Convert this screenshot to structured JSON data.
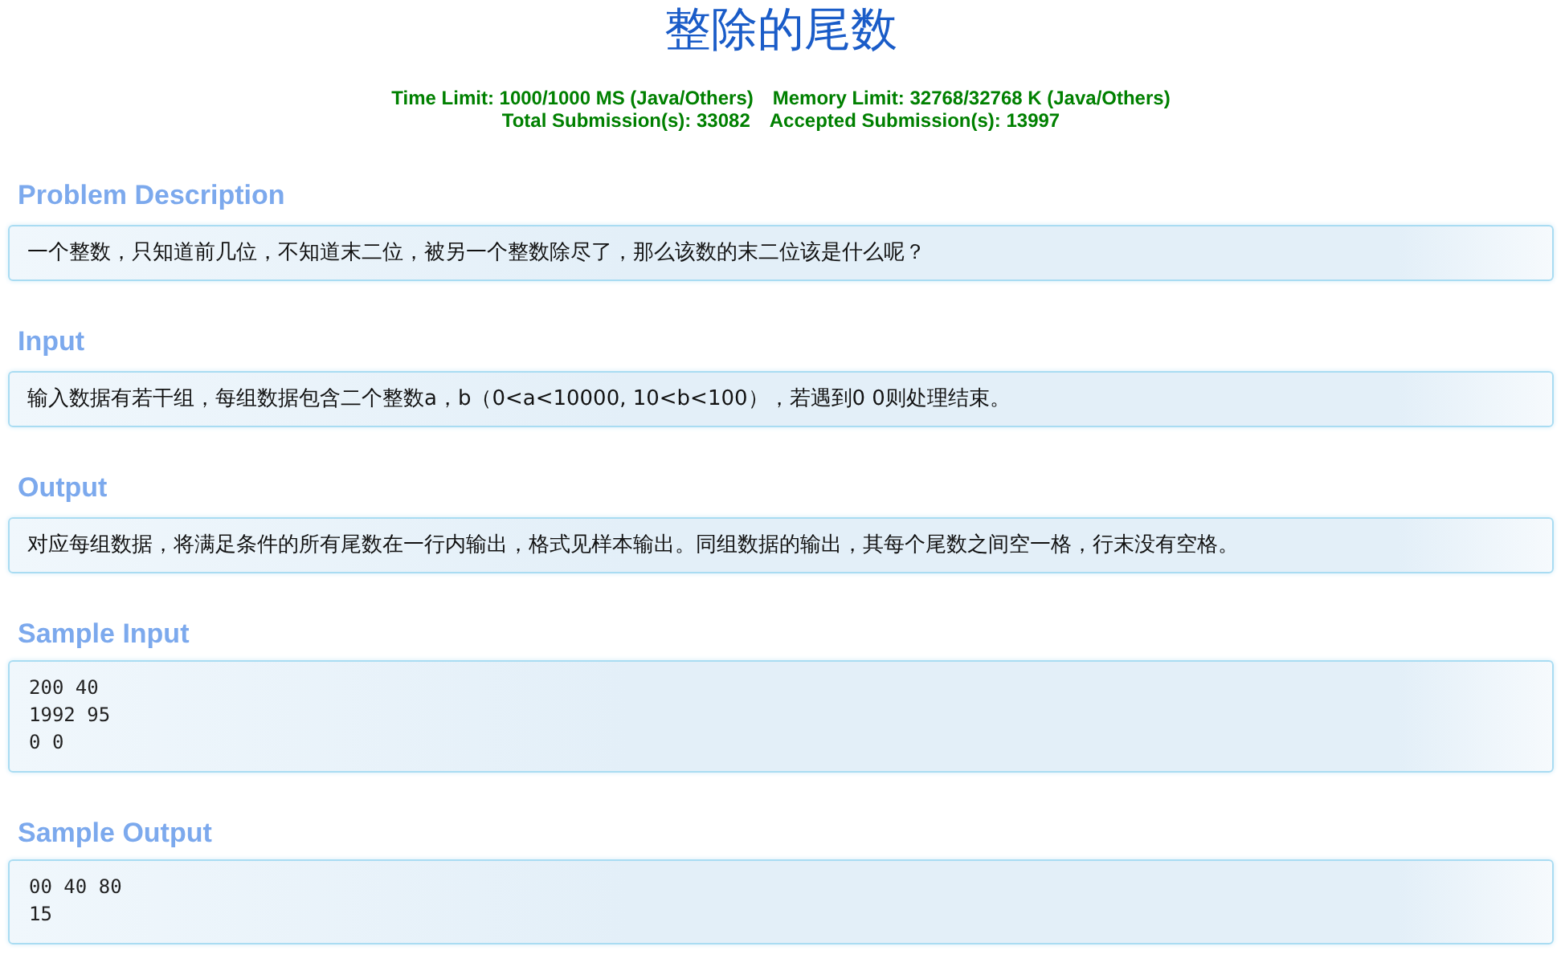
{
  "title": "整除的尾数",
  "limits": [
    [
      "Time Limit: 1000/1000 MS (Java/Others)",
      "Memory Limit: 32768/32768 K (Java/Others)"
    ],
    [
      "Total Submission(s): 33082",
      "Accepted Submission(s): 13997"
    ]
  ],
  "sections": [
    {
      "heading": "Problem Description",
      "kind": "text",
      "body": "一个整数，只知道前几位，不知道末二位，被另一个整数除尽了，那么该数的末二位该是什么呢？"
    },
    {
      "heading": "Input",
      "kind": "text",
      "body": "输入数据有若干组，每组数据包含二个整数a，b（0<a<10000, 10<b<100），若遇到0 0则处理结束。"
    },
    {
      "heading": "Output",
      "kind": "text",
      "body": "对应每组数据，将满足条件的所有尾数在一行内输出，格式见样本输出。同组数据的输出，其每个尾数之间空一格，行末没有空格。"
    },
    {
      "heading": "Sample Input",
      "kind": "code",
      "body": "200 40\n1992 95\n0 0"
    },
    {
      "heading": "Sample Output",
      "kind": "code",
      "body": "00 40 80\n15"
    }
  ]
}
